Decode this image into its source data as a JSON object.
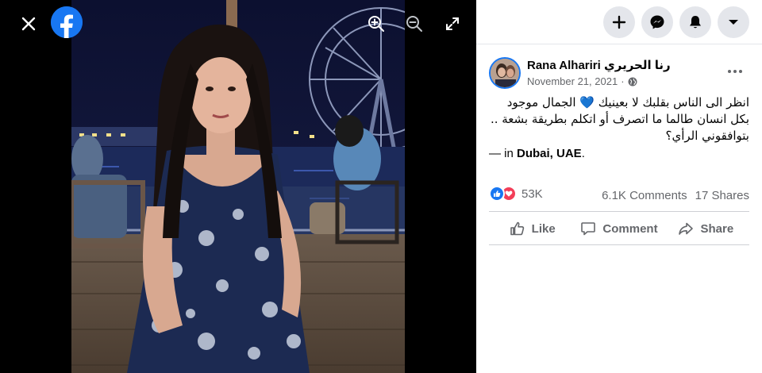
{
  "viewer": {
    "close_icon": "close-icon",
    "logo_icon": "facebook-logo",
    "zoom_in_icon": "zoom-in-icon",
    "zoom_out_icon": "zoom-out-icon",
    "fullscreen_icon": "fullscreen-icon"
  },
  "header": {
    "create_icon": "plus-icon",
    "messenger_icon": "messenger-icon",
    "notifications_icon": "bell-icon",
    "account_icon": "caret-down-icon"
  },
  "post": {
    "author": "Rana Alhariri رنا الحريري",
    "date": "November 21, 2021",
    "separator": "·",
    "privacy_icon": "globe-icon",
    "text_line1": "انظر الى الناس بقلبك لا بعينيك 💙 الجمال موجود",
    "text_line2": "بكل انسان طالما ما اتصرف أو اتكلم بطريقة بشعة ..",
    "text_line3": "بتوافقوني الرأي؟",
    "location_prefix": "— in ",
    "location": "Dubai, UAE",
    "location_suffix": "."
  },
  "reactions": {
    "count": "53K",
    "comments": "6.1K Comments",
    "shares": "17 Shares"
  },
  "actions": {
    "like": "Like",
    "comment": "Comment",
    "share": "Share"
  },
  "colors": {
    "facebook_blue": "#1877f2",
    "love_red": "#f33e58",
    "viewer_bg": "#000000",
    "button_gray": "#e4e6eb"
  }
}
